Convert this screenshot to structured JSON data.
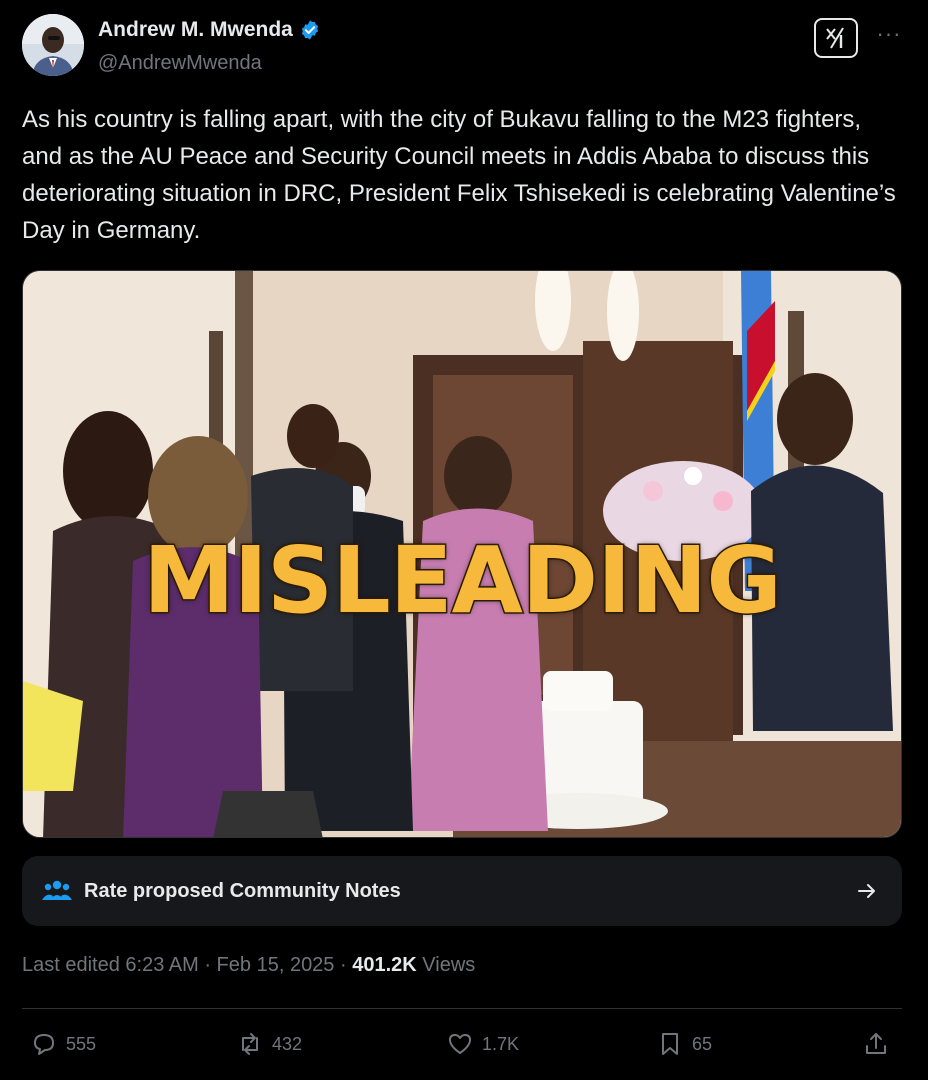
{
  "author": {
    "name": "Andrew M. Mwenda",
    "handle": "@AndrewMwenda",
    "verified": true
  },
  "tweet": {
    "text": "As his country is falling apart, with the city of Bukavu falling to the M23 fighters, and as the AU Peace and Security Council meets in Addis Ababa to discuss this deteriorating situation in DRC, President Felix Tshisekedi is celebrating Valentine’s Day in Germany."
  },
  "media": {
    "overlay_label": "MISLEADING",
    "overlay_color": "#f6b93b"
  },
  "community_notes": {
    "label": "Rate proposed Community Notes",
    "icon": "people-icon"
  },
  "meta": {
    "prefix": "Last edited 6:23 AM · Feb 15, 2025 · ",
    "views_count": "401.2K",
    "views_label": " Views"
  },
  "actions": {
    "replies": "555",
    "reposts": "432",
    "likes": "1.7K",
    "bookmarks": "65"
  },
  "colors": {
    "background": "#000000",
    "text": "#e7e9ea",
    "muted": "#71767b",
    "verified": "#1d9bf0",
    "notes_icon": "#1d9bf0"
  }
}
